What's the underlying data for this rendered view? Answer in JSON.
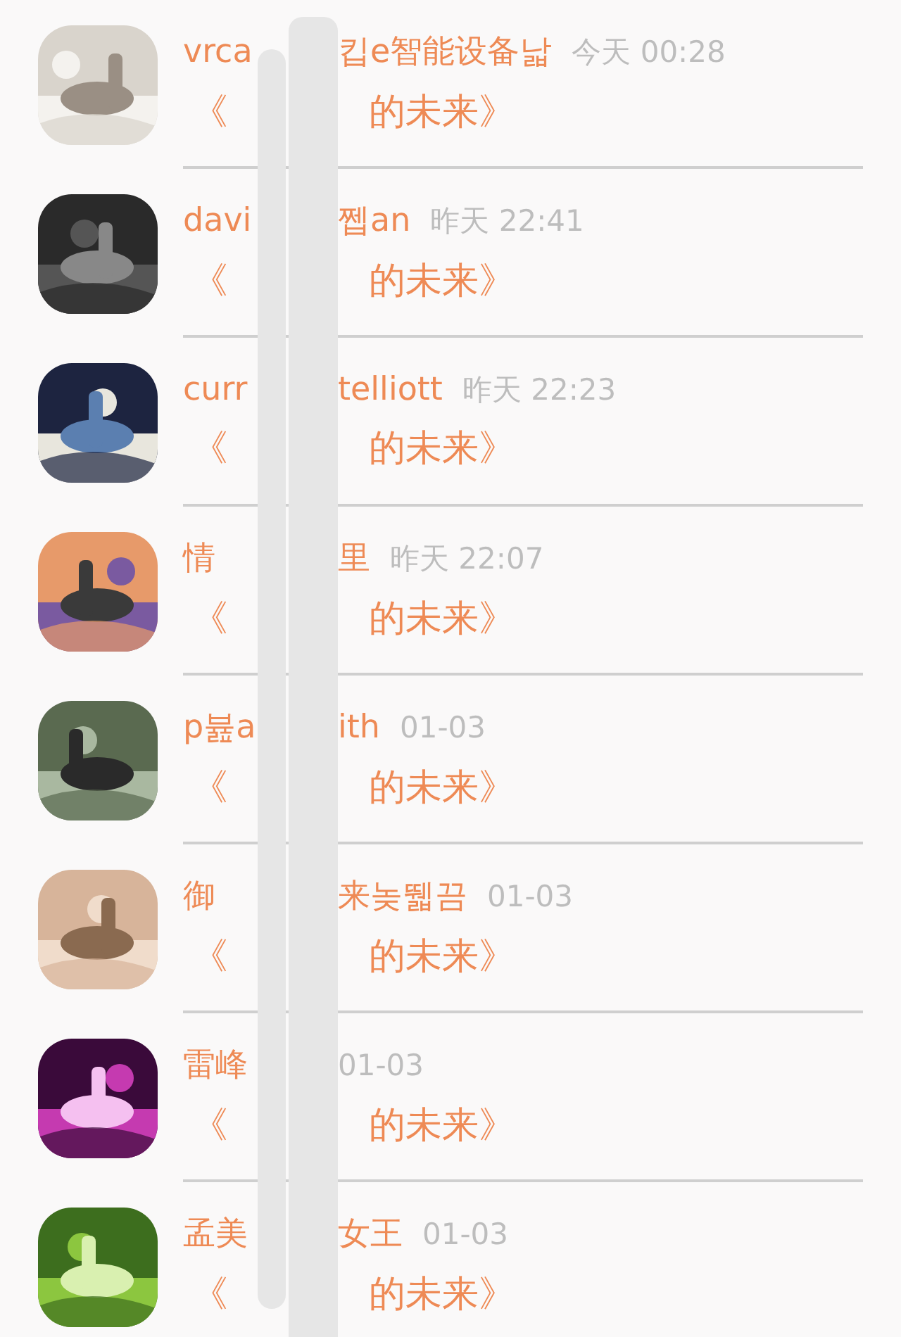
{
  "conversations": [
    {
      "name_left": "vrca",
      "name_right": "킵e智能设备낣",
      "time": "今天 00:28",
      "title_left": "《",
      "title_right": "的未来》"
    },
    {
      "name_left": "davi",
      "name_right": "쩹an",
      "time": "昨天 22:41",
      "title_left": "《",
      "title_right": "的未来》"
    },
    {
      "name_left": "curr",
      "name_right": "telliott",
      "time": "昨天 22:23",
      "title_left": "《",
      "title_right": "的未来》"
    },
    {
      "name_left": "情",
      "name_right": "里",
      "time": "昨天 22:07",
      "title_left": "《",
      "title_right": "的未来》"
    },
    {
      "name_left": "p뷾a",
      "name_right": "ith",
      "time": "01-03",
      "title_left": "《",
      "title_right": "的未来》"
    },
    {
      "name_left": "御",
      "name_right": "来놎뛟끔",
      "time": "01-03",
      "title_left": "《",
      "title_right": "的未来》"
    },
    {
      "name_left": "雷峰",
      "time": "01-03",
      "title_left": "《",
      "title_right": "的未来》"
    },
    {
      "name_left": "孟美",
      "name_right": "女王",
      "time": "01-03",
      "title_left": "《",
      "title_right": "的未来》"
    }
  ]
}
